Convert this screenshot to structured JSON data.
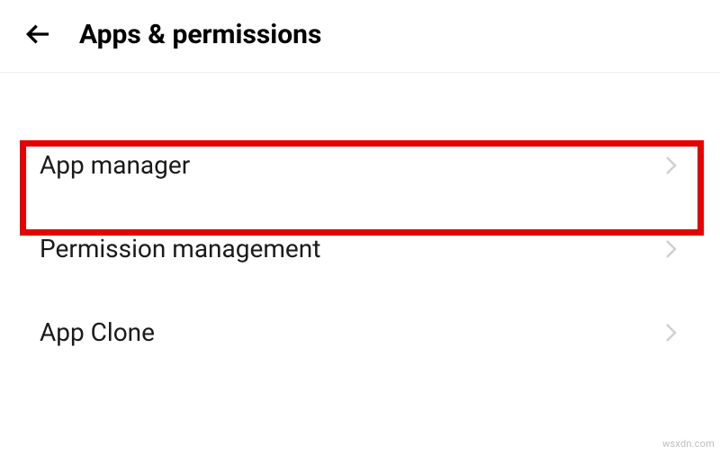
{
  "header": {
    "title": "Apps & permissions"
  },
  "items": [
    {
      "label": "App manager"
    },
    {
      "label": "Permission management"
    },
    {
      "label": "App Clone"
    }
  ],
  "watermark": "wsxdn.com"
}
